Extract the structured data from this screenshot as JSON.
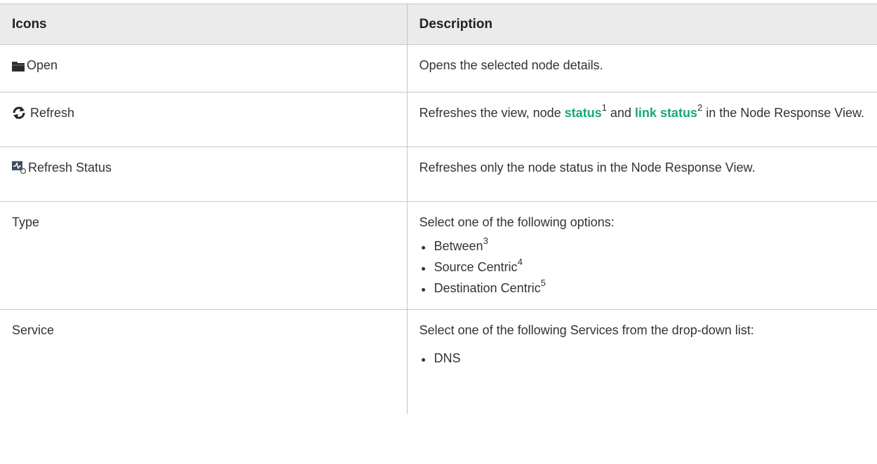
{
  "headers": {
    "icons": "Icons",
    "description": "Description"
  },
  "rows": {
    "open": {
      "name": "Open",
      "icon": "folder-icon",
      "desc": "Opens the selected node details."
    },
    "refresh": {
      "name": "Refresh",
      "icon": "refresh-icon",
      "desc_a": "Refreshes the view, node ",
      "link1": "status",
      "sup1": "1",
      "desc_b": " and ",
      "link2": "link status",
      "sup2": "2",
      "desc_c": " in the Node Response View."
    },
    "refresh_status": {
      "name": "Refresh Status",
      "icon": "node-status-refresh-icon",
      "desc": "Refreshes only the node status in the Node Response View."
    },
    "type": {
      "name": "Type",
      "desc": "Select one of the following options:",
      "options": [
        {
          "label": "Between",
          "sup": "3"
        },
        {
          "label": "Source Centric",
          "sup": "4"
        },
        {
          "label": "Destination Centric",
          "sup": "5"
        }
      ]
    },
    "service": {
      "name": "Service",
      "desc": "Select one of the following Services from the drop-down list:",
      "options": [
        {
          "label": "DNS"
        }
      ]
    }
  },
  "colors": {
    "link": "#1aa876",
    "header_bg": "#ebebeb",
    "border": "#c7c7c7"
  }
}
